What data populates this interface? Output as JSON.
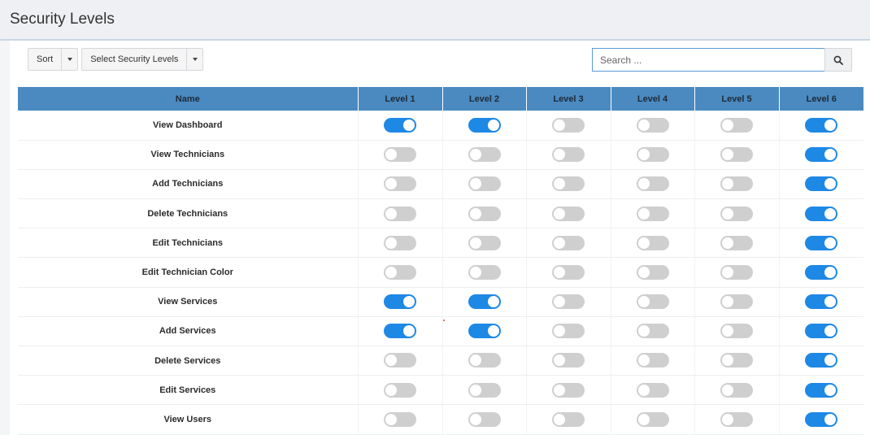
{
  "page": {
    "title": "Security Levels"
  },
  "toolbar": {
    "sort_label": "Sort",
    "select_levels_label": "Select Security Levels"
  },
  "search": {
    "placeholder": "Search ..."
  },
  "colors": {
    "header_bg": "#4a8ac0",
    "toggle_on": "#1e88e5",
    "toggle_off": "#cfcfcf"
  },
  "icons": {
    "search": "search-icon",
    "dropdown": "chevron-down-icon"
  },
  "table": {
    "columns": [
      "Name",
      "Level 1",
      "Level 2",
      "Level 3",
      "Level 4",
      "Level 5",
      "Level 6"
    ],
    "rows": [
      {
        "name": "View Dashboard",
        "levels": [
          true,
          true,
          false,
          false,
          false,
          true
        ]
      },
      {
        "name": "View Technicians",
        "levels": [
          false,
          false,
          false,
          false,
          false,
          true
        ]
      },
      {
        "name": "Add Technicians",
        "levels": [
          false,
          false,
          false,
          false,
          false,
          true
        ]
      },
      {
        "name": "Delete Technicians",
        "levels": [
          false,
          false,
          false,
          false,
          false,
          true
        ]
      },
      {
        "name": "Edit Technicians",
        "levels": [
          false,
          false,
          false,
          false,
          false,
          true
        ]
      },
      {
        "name": "Edit Technician Color",
        "levels": [
          false,
          false,
          false,
          false,
          false,
          true
        ]
      },
      {
        "name": "View Services",
        "levels": [
          true,
          true,
          false,
          false,
          false,
          true
        ]
      },
      {
        "name": "Add Services",
        "levels": [
          true,
          true,
          false,
          false,
          false,
          true
        ]
      },
      {
        "name": "Delete Services",
        "levels": [
          false,
          false,
          false,
          false,
          false,
          true
        ]
      },
      {
        "name": "Edit Services",
        "levels": [
          false,
          false,
          false,
          false,
          false,
          true
        ]
      },
      {
        "name": "View Users",
        "levels": [
          false,
          false,
          false,
          false,
          false,
          true
        ]
      }
    ]
  }
}
